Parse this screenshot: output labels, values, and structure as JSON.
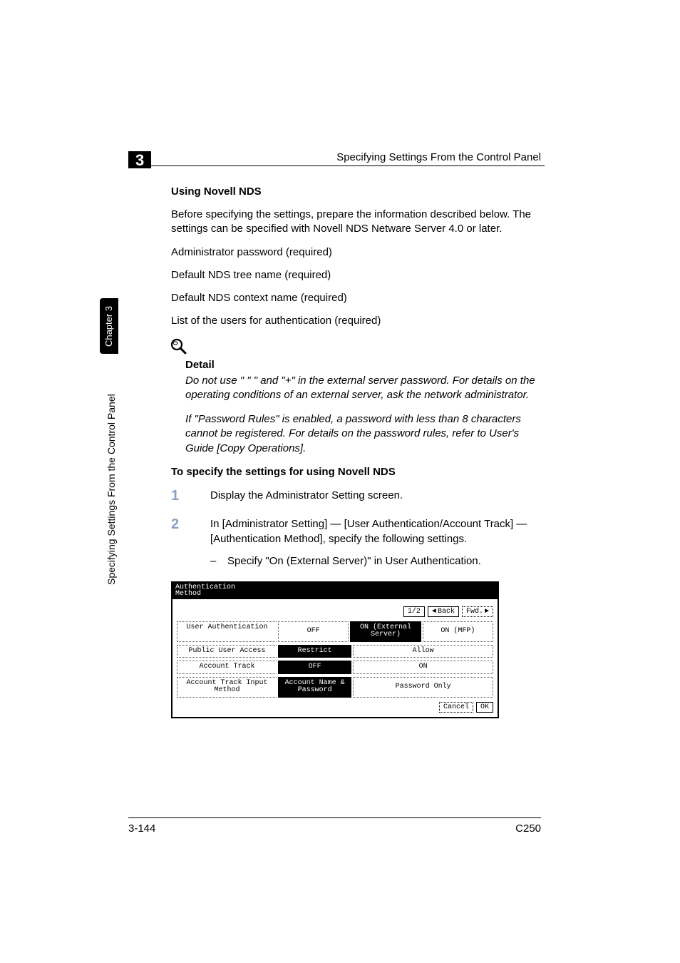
{
  "header": {
    "running_title": "Specifying Settings From the Control Panel",
    "chapter_number": "3"
  },
  "side": {
    "tab": "Chapter 3",
    "title": "Specifying Settings From the Control Panel"
  },
  "content": {
    "heading1": "Using Novell NDS",
    "p_intro": "Before specifying the settings, prepare the information described below. The settings can be specified with Novell NDS Netware Server 4.0 or later.",
    "p_req1": "Administrator password (required)",
    "p_req2": "Default NDS tree name (required)",
    "p_req3": "Default NDS context name (required)",
    "p_req4": "List of the users for authentication (required)",
    "detail_label": "Detail",
    "detail_p1": "Do not use \" \" \" and \"+\" in the external server password. For details on the operating conditions of an external server, ask the network administrator.",
    "detail_p2": "If \"Password Rules\" is enabled, a password with less than 8 characters cannot be registered. For details on the password rules, refer to User's Guide [Copy Operations].",
    "heading2": "To specify the settings for using Novell NDS",
    "steps": {
      "s1_num": "1",
      "s1": "Display the Administrator Setting screen.",
      "s2_num": "2",
      "s2": "In [Administrator Setting] — [User Authentication/Account Track] — [Authentication Method], specify the following settings.",
      "s2_bullet_dash": "–",
      "s2_bullet": "Specify \"On (External Server)\" in User Authentication."
    }
  },
  "panel": {
    "title_l1": "Authentication",
    "title_l2": "Method",
    "page_ind": "1/2",
    "back": "Back",
    "fwd": "Fwd.",
    "rows": {
      "r1_label": "User\nAuthentication",
      "r1_o1": "OFF",
      "r1_o2": "ON (External\nServer)",
      "r1_o3": "ON (MFP)",
      "r2_label": "Public User\nAccess",
      "r2_o1": "Restrict",
      "r2_o2": "Allow",
      "r3_label": "Account\nTrack",
      "r3_o1": "OFF",
      "r3_o2": "ON",
      "r4_label": "Account Track\nInput Method",
      "r4_o1": "Account Name &\nPassword",
      "r4_o2": "Password Only"
    },
    "cancel": "Cancel",
    "ok": "OK"
  },
  "footer": {
    "page": "3-144",
    "model": "C250"
  }
}
